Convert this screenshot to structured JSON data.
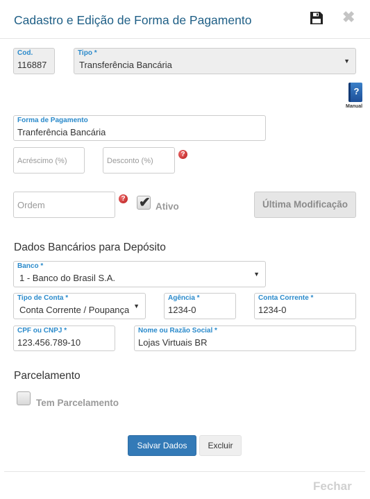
{
  "modal": {
    "title": "Cadastro e Edição de Forma de Pagamento",
    "icons": {
      "save": "floppy-disk-icon",
      "close": "close-x-icon"
    },
    "close_glyph": "✖"
  },
  "form": {
    "cod": {
      "label": "Cod.",
      "value": "116887"
    },
    "tipo": {
      "label": "Tipo *",
      "value": "Transferência Bancária"
    },
    "manual": {
      "label": "Manual",
      "glyph": "?"
    },
    "forma_pagamento": {
      "label": "Forma de Pagamento",
      "value": "Tranferência Bancária"
    },
    "acrescimo": {
      "placeholder": "Acréscimo (%)"
    },
    "desconto": {
      "placeholder": "Desconto (%)"
    },
    "help_glyph": "?",
    "ordem": {
      "placeholder": "Ordem"
    },
    "ativo": {
      "label": "Ativo",
      "checked": true
    },
    "ultima_modificacao": {
      "label": "Última Modificação"
    }
  },
  "dados_bancarios": {
    "heading": "Dados Bancários para Depósito",
    "banco": {
      "label": "Banco *",
      "value": "1 - Banco do Brasil S.A."
    },
    "tipo_conta": {
      "label": "Tipo de Conta *",
      "value": "Conta Corrente / Poupança"
    },
    "agencia": {
      "label": "Agência *",
      "value": "1234-0"
    },
    "conta_corrente": {
      "label": "Conta Corrente *",
      "value": "1234-0"
    },
    "cpf_cnpj": {
      "label": "CPF ou CNPJ *",
      "value": "123.456.789-10"
    },
    "nome_razao": {
      "label": "Nome ou Razão Social *",
      "value": "Lojas Virtuais BR"
    }
  },
  "parcelamento": {
    "heading": "Parcelamento",
    "tem_parcelamento": {
      "label": "Tem Parcelamento",
      "checked": false
    }
  },
  "actions": {
    "salvar": "Salvar Dados",
    "excluir": "Excluir",
    "fechar": "Fechar"
  },
  "colors": {
    "title": "#1f5f86",
    "field_label": "#2a8acb",
    "primary_button": "#337ab7",
    "help_icon": "#c62828"
  }
}
